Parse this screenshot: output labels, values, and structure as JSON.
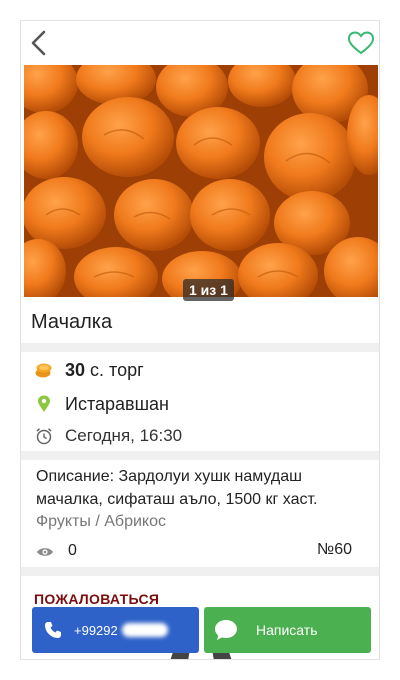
{
  "listing": {
    "title": "Мачалка",
    "image_counter": "1 из 1",
    "price_value": "30",
    "price_suffix": "с. торг",
    "location": "Истаравшан",
    "posted": "Сегодня, 16:30",
    "description": "Описание: Зардолуи хушк намудаш мачалка, сифаташ аъло, 1500 кг хаст.",
    "category": "Фрукты / Абрикос",
    "views": "0",
    "ad_number": "№60",
    "complain_label": "ПОЖАЛОВАТЬСЯ"
  },
  "actions": {
    "call_number": "+99292",
    "write_label": "Написать"
  },
  "icons": {
    "back": "chevron-left-icon",
    "favorite": "heart-outline-icon",
    "price": "coins-icon",
    "location": "map-pin-icon",
    "time": "alarm-clock-icon",
    "views": "eye-icon",
    "call": "phone-icon",
    "write": "chat-bubble-icon"
  },
  "colors": {
    "favorite": "#3bb873",
    "location_pin": "#8dc63f",
    "price_coins": "#f5a623",
    "call_button": "#2f62c8",
    "write_button": "#4bb04f",
    "complain": "#7a0e0e"
  }
}
